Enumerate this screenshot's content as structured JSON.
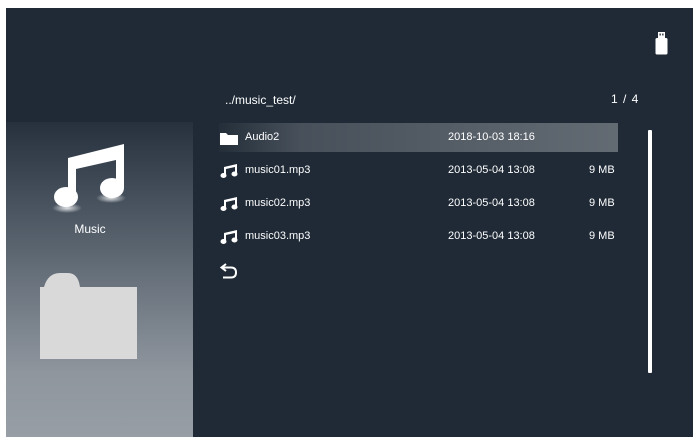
{
  "sidebar": {
    "items": [
      {
        "label": "Music",
        "icon": "music-note-icon"
      },
      {
        "label": "",
        "icon": "folder-icon"
      }
    ]
  },
  "status": {
    "icon": "usb-drive-icon"
  },
  "browser": {
    "path": "../music_test/",
    "page": "1 / 4",
    "files": [
      {
        "name": "Audio2",
        "date": "2018-10-03 18:16",
        "size": "",
        "icon": "folder-icon",
        "selected": true
      },
      {
        "name": "music01.mp3",
        "date": "2013-05-04 13:08",
        "size": "9 MB",
        "icon": "music-note-icon"
      },
      {
        "name": "music02.mp3",
        "date": "2013-05-04 13:08",
        "size": "9 MB",
        "icon": "music-note-icon"
      },
      {
        "name": "music03.mp3",
        "date": "2013-05-04 13:08",
        "size": "9 MB",
        "icon": "music-note-icon"
      }
    ],
    "back_icon": "return-arrow-icon"
  },
  "colors": {
    "background": "#1f2a36",
    "text": "#ffffff",
    "folder": "#d9d9d9"
  }
}
